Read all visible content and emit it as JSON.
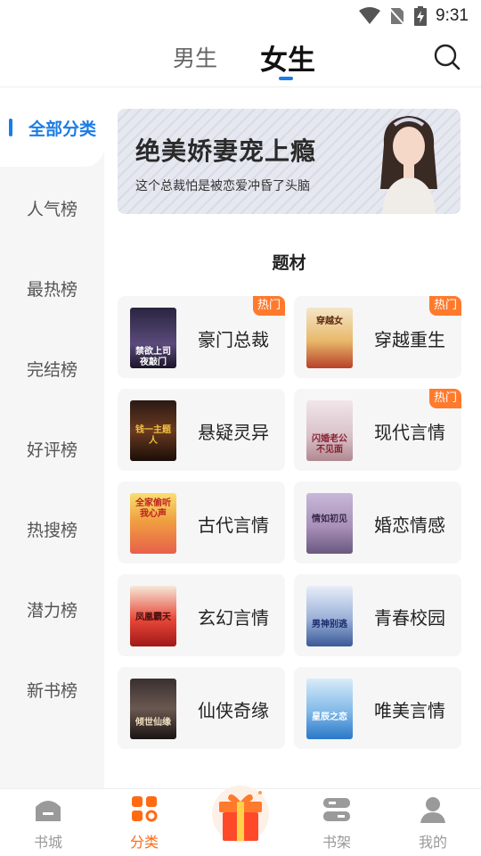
{
  "status_bar": {
    "time": "9:31"
  },
  "gender_tabs": {
    "male": "男生",
    "female": "女生"
  },
  "sidebar": {
    "items": [
      {
        "label": "全部分类",
        "active": true
      },
      {
        "label": "人气榜"
      },
      {
        "label": "最热榜"
      },
      {
        "label": "完结榜"
      },
      {
        "label": "好评榜"
      },
      {
        "label": "热搜榜"
      },
      {
        "label": "潜力榜"
      },
      {
        "label": "新书榜"
      }
    ]
  },
  "banner": {
    "title": "绝美娇妻宠上瘾",
    "subtitle": "这个总裁怕是被恋爱冲昏了头脑"
  },
  "section": {
    "title": "题材"
  },
  "categories": [
    {
      "label": "豪门总裁",
      "hot": "热门",
      "cover_text": "禁欲上司夜敲门"
    },
    {
      "label": "穿越重生",
      "hot": "热门",
      "cover_text": "穿越女"
    },
    {
      "label": "悬疑灵异",
      "cover_text": "钱一主题人"
    },
    {
      "label": "现代言情",
      "hot": "热门",
      "cover_text": "闪婚老公不见面"
    },
    {
      "label": "古代言情",
      "cover_text": "全家偷听我心声"
    },
    {
      "label": "婚恋情感",
      "cover_text": "情如初见"
    },
    {
      "label": "玄幻言情",
      "cover_text": "凤凰霸天"
    },
    {
      "label": "青春校园",
      "cover_text": "男神别逃"
    },
    {
      "label": "仙侠奇缘",
      "cover_text": "倾世仙缘"
    },
    {
      "label": "唯美言情",
      "cover_text": "星辰之恋"
    }
  ],
  "bottom_nav": {
    "items": [
      {
        "label": "书城",
        "icon": "bookstore-icon"
      },
      {
        "label": "分类",
        "icon": "category-icon",
        "active": true
      },
      {
        "label": "",
        "icon": "gift-icon"
      },
      {
        "label": "书架",
        "icon": "bookshelf-icon"
      },
      {
        "label": "我的",
        "icon": "profile-icon"
      }
    ]
  },
  "colors": {
    "accent": "#1b7ce6",
    "hot": "#ff7a2c",
    "nav_active": "#ff6a13"
  }
}
